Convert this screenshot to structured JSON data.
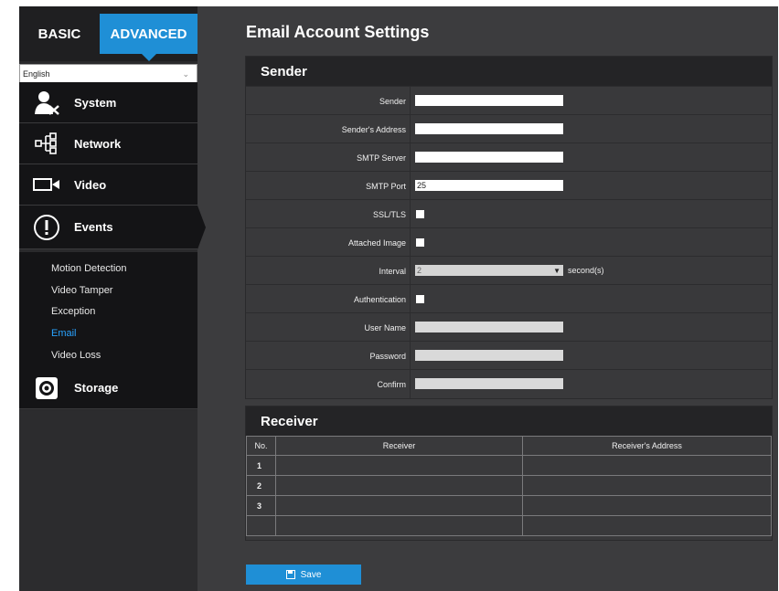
{
  "tabs": {
    "basic": "BASIC",
    "advanced": "ADVANCED"
  },
  "language": {
    "selected": "English"
  },
  "nav": {
    "system": "System",
    "network": "Network",
    "video": "Video",
    "events": "Events",
    "storage": "Storage"
  },
  "events_sub": {
    "items": [
      "Motion Detection",
      "Video Tamper",
      "Exception",
      "Email",
      "Video Loss"
    ],
    "active": "Email"
  },
  "page_title": "Email Account Settings",
  "sender": {
    "heading": "Sender",
    "fields": {
      "sender": {
        "label": "Sender",
        "value": ""
      },
      "sender_address": {
        "label": "Sender's Address",
        "value": ""
      },
      "smtp_server": {
        "label": "SMTP Server",
        "value": ""
      },
      "smtp_port": {
        "label": "SMTP Port",
        "value": "25"
      },
      "ssl_tls": {
        "label": "SSL/TLS",
        "checked": false
      },
      "attached_image": {
        "label": "Attached Image",
        "checked": false
      },
      "interval": {
        "label": "Interval",
        "value": "2",
        "unit": "second(s)"
      },
      "authentication": {
        "label": "Authentication",
        "checked": false
      },
      "user_name": {
        "label": "User Name",
        "value": ""
      },
      "password": {
        "label": "Password",
        "value": ""
      },
      "confirm": {
        "label": "Confirm",
        "value": ""
      }
    }
  },
  "receiver": {
    "heading": "Receiver",
    "columns": [
      "No.",
      "Receiver",
      "Receiver's Address"
    ],
    "rows": [
      {
        "no": "1",
        "receiver": "",
        "address": ""
      },
      {
        "no": "2",
        "receiver": "",
        "address": ""
      },
      {
        "no": "3",
        "receiver": "",
        "address": ""
      },
      {
        "no": "",
        "receiver": "",
        "address": ""
      }
    ]
  },
  "save_label": "Save",
  "colors": {
    "accent": "#1f8fd6",
    "active_link": "#29a3ff"
  }
}
